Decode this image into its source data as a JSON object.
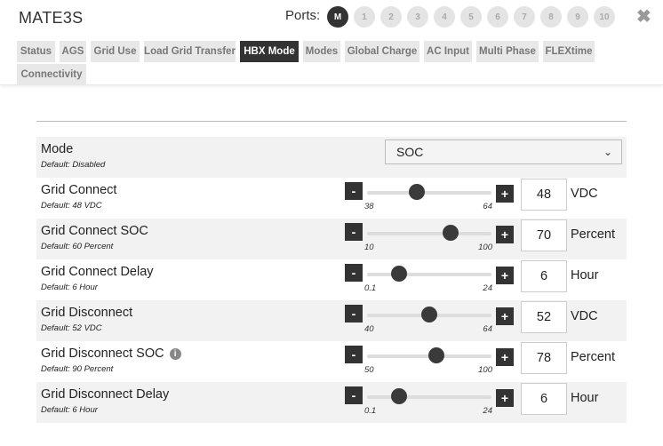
{
  "header": {
    "title": "MATE3S",
    "ports_label": "Ports:",
    "ports": [
      "M",
      "1",
      "2",
      "3",
      "4",
      "5",
      "6",
      "7",
      "8",
      "9",
      "10"
    ],
    "active_port": "M",
    "close_glyph": "✖"
  },
  "tabs": [
    {
      "label": "Status"
    },
    {
      "label": "AGS"
    },
    {
      "label": "Grid Use"
    },
    {
      "label": "Load Grid Transfer"
    },
    {
      "label": "HBX Mode",
      "active": true
    },
    {
      "label": "Modes"
    },
    {
      "label": "Global Charge"
    },
    {
      "label": "AC Input"
    },
    {
      "label": "Multi Phase"
    },
    {
      "label": "FLEXtime"
    },
    {
      "label": "Connectivity"
    }
  ],
  "mode": {
    "label": "Mode",
    "default": "Default: Disabled",
    "value": "SOC",
    "chevron": "⌄"
  },
  "settings": [
    {
      "name": "grid-connect",
      "label": "Grid Connect",
      "default": "Default: 48 VDC",
      "min": "38",
      "max": "64",
      "value": "48",
      "unit": "VDC",
      "fraction": 0.4
    },
    {
      "name": "grid-connect-soc",
      "label": "Grid Connect SOC",
      "default": "Default: 60 Percent",
      "min": "10",
      "max": "100",
      "value": "70",
      "unit": "Percent",
      "fraction": 0.67
    },
    {
      "name": "grid-connect-delay",
      "label": "Grid Connect Delay",
      "default": "Default: 6 Hour",
      "min": "0.1",
      "max": "24",
      "value": "6",
      "unit": "Hour",
      "fraction": 0.26
    },
    {
      "name": "grid-disconnect",
      "label": "Grid Disconnect",
      "default": "Default: 52 VDC",
      "min": "40",
      "max": "64",
      "value": "52",
      "unit": "VDC",
      "fraction": 0.5
    },
    {
      "name": "grid-disconnect-soc",
      "label": "Grid Disconnect SOC",
      "default": "Default: 90 Percent",
      "min": "50",
      "max": "100",
      "value": "78",
      "unit": "Percent",
      "fraction": 0.56,
      "info": true
    },
    {
      "name": "grid-disconnect-delay",
      "label": "Grid Disconnect Delay",
      "default": "Default: 6 Hour",
      "min": "0.1",
      "max": "24",
      "value": "6",
      "unit": "Hour",
      "fraction": 0.26
    }
  ],
  "icons": {
    "minus": "-",
    "plus": "+",
    "info": "i"
  }
}
